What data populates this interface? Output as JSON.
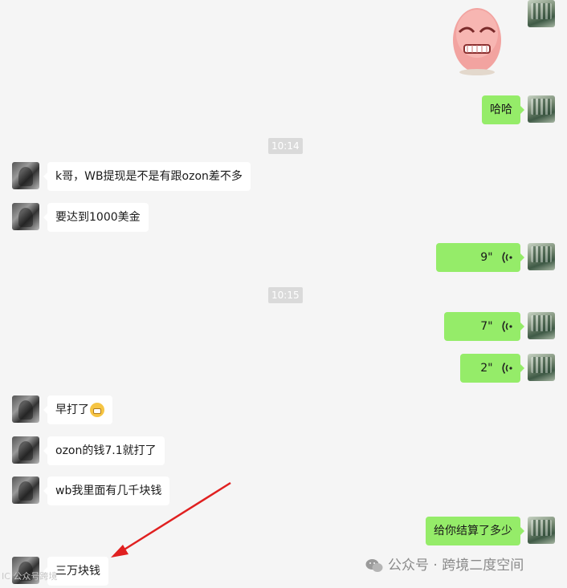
{
  "messages": {
    "m1_haha": "哈哈",
    "t1": "10:14",
    "m2": "k哥，WB提现是不是有跟ozon差不多",
    "m3": "要达到1000美金",
    "v1": "9\"",
    "t2": "10:15",
    "v2": "7\"",
    "v3": "2\"",
    "m4": "早打了",
    "m5": "ozon的钱7.1就打了",
    "m6": "wb我里面有几千块钱",
    "m7": "给你结算了多少",
    "m8": "三万块钱"
  },
  "watermark": {
    "text": "公众号 · 跨境二度空间",
    "corner": "IC 公众号跨境"
  },
  "colors": {
    "outgoing_bubble": "#95ec69",
    "incoming_bubble": "#ffffff",
    "background": "#f5f5f5",
    "arrow": "#e02020"
  },
  "icons": {
    "voice": "voice-wave-icon",
    "emoji": "grinning-face-emoji",
    "sticker": "angry-face-sticker",
    "wechat": "wechat-logo-icon"
  }
}
